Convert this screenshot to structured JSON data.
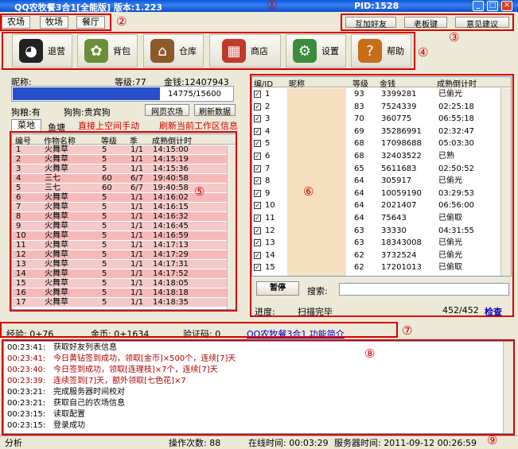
{
  "titlebar": {
    "title": "QQ农牧餐3合1[全能版]  版本:1.223",
    "pid": "PID:1528"
  },
  "tabs": [
    "农场",
    "牧场",
    "餐厅"
  ],
  "top_right": {
    "btn1": "互加好友",
    "btn2": "老板键",
    "btn3": "意见建议"
  },
  "toolbar": [
    {
      "label": "退营",
      "icon": "penguin-icon"
    },
    {
      "label": "背包",
      "icon": "bag-icon"
    },
    {
      "label": "仓库",
      "icon": "warehouse-icon"
    },
    {
      "label": "商店",
      "icon": "shop-icon"
    },
    {
      "label": "设置",
      "icon": "settings-icon"
    },
    {
      "label": "帮助",
      "icon": "help-icon"
    }
  ],
  "info": {
    "nick_label": "昵称:",
    "level_label": "等级:77",
    "money_label": "金钱:12407943",
    "progress": "14775/15600",
    "dog_food": "狗粮:有",
    "dog": "狗狗:贵宾狗",
    "webfarm": "网页农场",
    "refresh": "刷新数据",
    "sub_tab1": "菜地",
    "sub_tab2": "鱼塘",
    "annot1": "直接上空间手动",
    "annot2": "刷新当前工作区信息"
  },
  "left_table": {
    "headers": [
      "编号",
      "作物名称",
      "等级",
      "季",
      "成熟倒计时"
    ],
    "rows": [
      [
        "1",
        "火舞草",
        "5",
        "1/1",
        "14:15:00"
      ],
      [
        "2",
        "火舞草",
        "5",
        "1/1",
        "14:15:19"
      ],
      [
        "3",
        "火舞草",
        "5",
        "1/1",
        "14:15:36"
      ],
      [
        "4",
        "三七",
        "60",
        "6/7",
        "19:40:58"
      ],
      [
        "5",
        "三七",
        "60",
        "6/7",
        "19:40:58"
      ],
      [
        "6",
        "火舞草",
        "5",
        "1/1",
        "14:16:02"
      ],
      [
        "7",
        "火舞草",
        "5",
        "1/1",
        "14:16:15"
      ],
      [
        "8",
        "火舞草",
        "5",
        "1/1",
        "14:16:32"
      ],
      [
        "9",
        "火舞草",
        "5",
        "1/1",
        "14:16:45"
      ],
      [
        "10",
        "火舞草",
        "5",
        "1/1",
        "14:16:59"
      ],
      [
        "11",
        "火舞草",
        "5",
        "1/1",
        "14:17:13"
      ],
      [
        "12",
        "火舞草",
        "5",
        "1/1",
        "14:17:29"
      ],
      [
        "13",
        "火舞草",
        "5",
        "1/1",
        "14:17:31"
      ],
      [
        "14",
        "火舞草",
        "5",
        "1/1",
        "14:17:52"
      ],
      [
        "15",
        "火舞草",
        "5",
        "1/1",
        "14:18:05"
      ],
      [
        "16",
        "火舞草",
        "5",
        "1/1",
        "14:18:18"
      ],
      [
        "17",
        "火舞草",
        "5",
        "1/1",
        "14:18:35"
      ]
    ]
  },
  "right_table": {
    "headers": [
      "编/ID",
      "昵称",
      "等级",
      "金钱",
      "成熟倒计时"
    ],
    "rows": [
      [
        "1",
        "93",
        "3399281",
        "已偷光"
      ],
      [
        "2",
        "83",
        "7524339",
        "02:25:18"
      ],
      [
        "3",
        "70",
        "360775",
        "06:55:18"
      ],
      [
        "4",
        "69",
        "35286991",
        "02:32:47"
      ],
      [
        "5",
        "68",
        "17098688",
        "05:03:30"
      ],
      [
        "6",
        "68",
        "32403522",
        "已熟"
      ],
      [
        "7",
        "65",
        "5611683",
        "02:50:52"
      ],
      [
        "8",
        "64",
        "305917",
        "已偷光"
      ],
      [
        "9",
        "64",
        "10059190",
        "03:29:53"
      ],
      [
        "10",
        "64",
        "2021407",
        "06:56:00"
      ],
      [
        "11",
        "64",
        "75643",
        "已偷取"
      ],
      [
        "12",
        "63",
        "33330",
        "04:31:55"
      ],
      [
        "13",
        "63",
        "18343008",
        "已偷光"
      ],
      [
        "14",
        "62",
        "3732524",
        "已偷光"
      ],
      [
        "15",
        "62",
        "17201013",
        "已偷取"
      ]
    ],
    "pause": "暂停",
    "search_label": "搜索:",
    "progress_label": "进度:",
    "status": "扫描完毕",
    "count": "452/452",
    "check": "检查"
  },
  "statusline": {
    "exp": "经验: 0+76",
    "gold": "金币: 0+1634",
    "code": "验证码: 0",
    "link": "QQ农牧餐3合1 功能简介"
  },
  "log": [
    {
      "t": "00:23:41:",
      "m": "获取好友列表信息",
      "red": false
    },
    {
      "t": "00:23:41:",
      "m": "今日黄钻签到成功，领取[金币]×500个，连续[7]天",
      "red": true
    },
    {
      "t": "00:23:40:",
      "m": "今日签到成功，领取[连理枝]×7个，连续[7]天",
      "red": true
    },
    {
      "t": "00:23:39:",
      "m": "连续签到[7]天，额外领取[七色花]×7",
      "red": true
    },
    {
      "t": "00:23:21:",
      "m": "完成服务器时间校对",
      "red": false
    },
    {
      "t": "00:23:21:",
      "m": "获取自己的农场信息",
      "red": false
    },
    {
      "t": "00:23:15:",
      "m": "读取配置",
      "red": false
    },
    {
      "t": "00:23:15:",
      "m": "登录成功",
      "red": false
    }
  ],
  "bottom": {
    "analyze": "分析",
    "ops": "操作次数: 88",
    "online": "在线时间: 00:03:29",
    "server": "服务器时间: 2011-09-12 00:26:59"
  },
  "markers": [
    "①",
    "②",
    "③",
    "④",
    "⑤",
    "⑥",
    "⑦",
    "⑧",
    "⑨"
  ]
}
